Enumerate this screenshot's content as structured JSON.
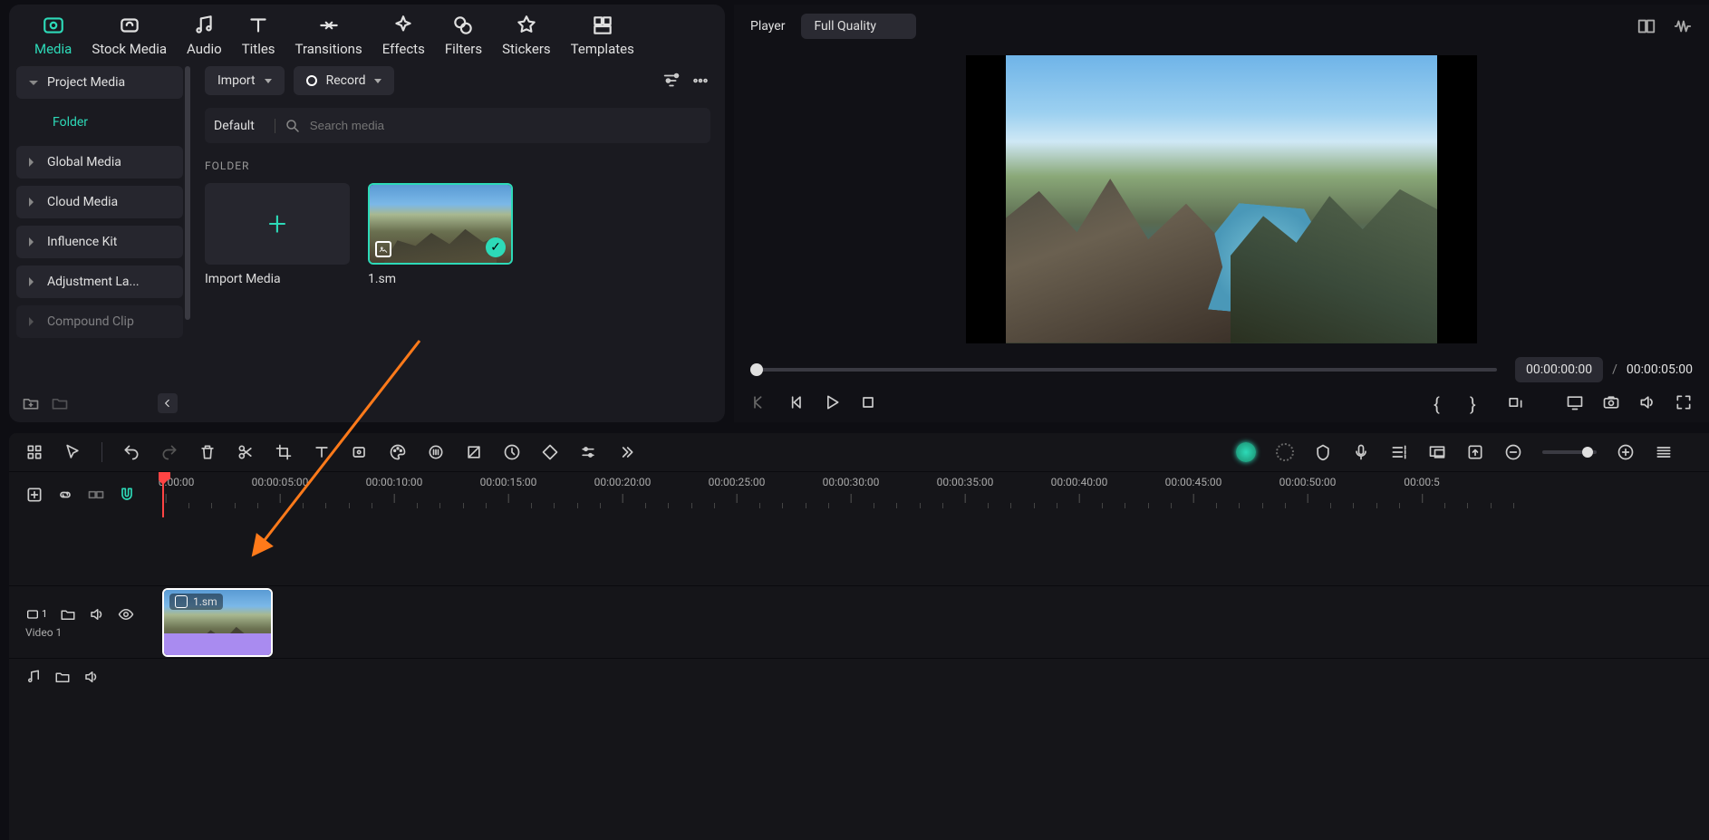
{
  "tabs": {
    "media": "Media",
    "stock_media": "Stock Media",
    "audio": "Audio",
    "titles": "Titles",
    "transitions": "Transitions",
    "effects": "Effects",
    "filters": "Filters",
    "stickers": "Stickers",
    "templates": "Templates"
  },
  "sidebar": {
    "project_media": "Project Media",
    "folder": "Folder",
    "global_media": "Global Media",
    "cloud_media": "Cloud Media",
    "influence_kit": "Influence Kit",
    "adjustment_layer": "Adjustment La...",
    "compound_clip": "Compound Clip"
  },
  "media": {
    "import": "Import",
    "record": "Record",
    "default": "Default",
    "search_placeholder": "Search media",
    "folder_label": "FOLDER",
    "import_media": "Import Media",
    "item_name": "1.sm"
  },
  "player": {
    "title": "Player",
    "quality": "Full Quality",
    "time_current": "00:00:00:00",
    "time_total": "00:00:05:00",
    "sep": "/"
  },
  "timeline": {
    "ruler": [
      "00:00:00:00",
      "00:00:05:00",
      "00:00:10:00",
      "00:00:15:00",
      "00:00:20:00",
      "00:00:25:00",
      "00:00:30:00",
      "00:00:35:00",
      "00:00:40:00",
      "00:00:45:00",
      "00:00:50:00",
      "00:00:5"
    ],
    "track1_num": "1",
    "track1_label": "Video 1",
    "clip_label": "1.sm"
  }
}
